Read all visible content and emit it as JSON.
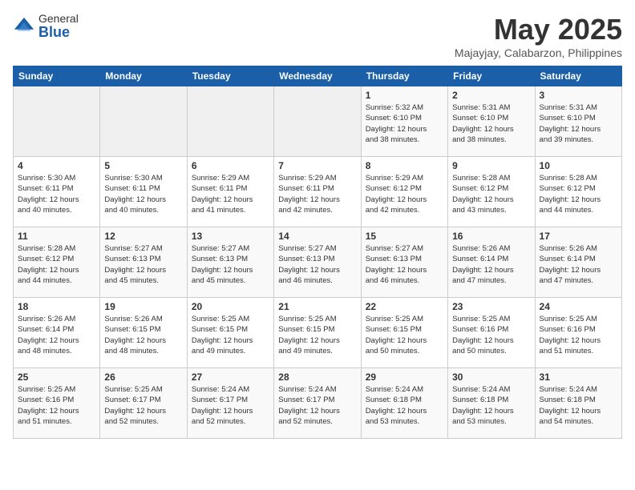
{
  "logo": {
    "general": "General",
    "blue": "Blue"
  },
  "title": "May 2025",
  "subtitle": "Majayjay, Calabarzon, Philippines",
  "days_header": [
    "Sunday",
    "Monday",
    "Tuesday",
    "Wednesday",
    "Thursday",
    "Friday",
    "Saturday"
  ],
  "weeks": [
    [
      {
        "day": "",
        "info": ""
      },
      {
        "day": "",
        "info": ""
      },
      {
        "day": "",
        "info": ""
      },
      {
        "day": "",
        "info": ""
      },
      {
        "day": "1",
        "info": "Sunrise: 5:32 AM\nSunset: 6:10 PM\nDaylight: 12 hours\nand 38 minutes."
      },
      {
        "day": "2",
        "info": "Sunrise: 5:31 AM\nSunset: 6:10 PM\nDaylight: 12 hours\nand 38 minutes."
      },
      {
        "day": "3",
        "info": "Sunrise: 5:31 AM\nSunset: 6:10 PM\nDaylight: 12 hours\nand 39 minutes."
      }
    ],
    [
      {
        "day": "4",
        "info": "Sunrise: 5:30 AM\nSunset: 6:11 PM\nDaylight: 12 hours\nand 40 minutes."
      },
      {
        "day": "5",
        "info": "Sunrise: 5:30 AM\nSunset: 6:11 PM\nDaylight: 12 hours\nand 40 minutes."
      },
      {
        "day": "6",
        "info": "Sunrise: 5:29 AM\nSunset: 6:11 PM\nDaylight: 12 hours\nand 41 minutes."
      },
      {
        "day": "7",
        "info": "Sunrise: 5:29 AM\nSunset: 6:11 PM\nDaylight: 12 hours\nand 42 minutes."
      },
      {
        "day": "8",
        "info": "Sunrise: 5:29 AM\nSunset: 6:12 PM\nDaylight: 12 hours\nand 42 minutes."
      },
      {
        "day": "9",
        "info": "Sunrise: 5:28 AM\nSunset: 6:12 PM\nDaylight: 12 hours\nand 43 minutes."
      },
      {
        "day": "10",
        "info": "Sunrise: 5:28 AM\nSunset: 6:12 PM\nDaylight: 12 hours\nand 44 minutes."
      }
    ],
    [
      {
        "day": "11",
        "info": "Sunrise: 5:28 AM\nSunset: 6:12 PM\nDaylight: 12 hours\nand 44 minutes."
      },
      {
        "day": "12",
        "info": "Sunrise: 5:27 AM\nSunset: 6:13 PM\nDaylight: 12 hours\nand 45 minutes."
      },
      {
        "day": "13",
        "info": "Sunrise: 5:27 AM\nSunset: 6:13 PM\nDaylight: 12 hours\nand 45 minutes."
      },
      {
        "day": "14",
        "info": "Sunrise: 5:27 AM\nSunset: 6:13 PM\nDaylight: 12 hours\nand 46 minutes."
      },
      {
        "day": "15",
        "info": "Sunrise: 5:27 AM\nSunset: 6:13 PM\nDaylight: 12 hours\nand 46 minutes."
      },
      {
        "day": "16",
        "info": "Sunrise: 5:26 AM\nSunset: 6:14 PM\nDaylight: 12 hours\nand 47 minutes."
      },
      {
        "day": "17",
        "info": "Sunrise: 5:26 AM\nSunset: 6:14 PM\nDaylight: 12 hours\nand 47 minutes."
      }
    ],
    [
      {
        "day": "18",
        "info": "Sunrise: 5:26 AM\nSunset: 6:14 PM\nDaylight: 12 hours\nand 48 minutes."
      },
      {
        "day": "19",
        "info": "Sunrise: 5:26 AM\nSunset: 6:15 PM\nDaylight: 12 hours\nand 48 minutes."
      },
      {
        "day": "20",
        "info": "Sunrise: 5:25 AM\nSunset: 6:15 PM\nDaylight: 12 hours\nand 49 minutes."
      },
      {
        "day": "21",
        "info": "Sunrise: 5:25 AM\nSunset: 6:15 PM\nDaylight: 12 hours\nand 49 minutes."
      },
      {
        "day": "22",
        "info": "Sunrise: 5:25 AM\nSunset: 6:15 PM\nDaylight: 12 hours\nand 50 minutes."
      },
      {
        "day": "23",
        "info": "Sunrise: 5:25 AM\nSunset: 6:16 PM\nDaylight: 12 hours\nand 50 minutes."
      },
      {
        "day": "24",
        "info": "Sunrise: 5:25 AM\nSunset: 6:16 PM\nDaylight: 12 hours\nand 51 minutes."
      }
    ],
    [
      {
        "day": "25",
        "info": "Sunrise: 5:25 AM\nSunset: 6:16 PM\nDaylight: 12 hours\nand 51 minutes."
      },
      {
        "day": "26",
        "info": "Sunrise: 5:25 AM\nSunset: 6:17 PM\nDaylight: 12 hours\nand 52 minutes."
      },
      {
        "day": "27",
        "info": "Sunrise: 5:24 AM\nSunset: 6:17 PM\nDaylight: 12 hours\nand 52 minutes."
      },
      {
        "day": "28",
        "info": "Sunrise: 5:24 AM\nSunset: 6:17 PM\nDaylight: 12 hours\nand 52 minutes."
      },
      {
        "day": "29",
        "info": "Sunrise: 5:24 AM\nSunset: 6:18 PM\nDaylight: 12 hours\nand 53 minutes."
      },
      {
        "day": "30",
        "info": "Sunrise: 5:24 AM\nSunset: 6:18 PM\nDaylight: 12 hours\nand 53 minutes."
      },
      {
        "day": "31",
        "info": "Sunrise: 5:24 AM\nSunset: 6:18 PM\nDaylight: 12 hours\nand 54 minutes."
      }
    ]
  ]
}
